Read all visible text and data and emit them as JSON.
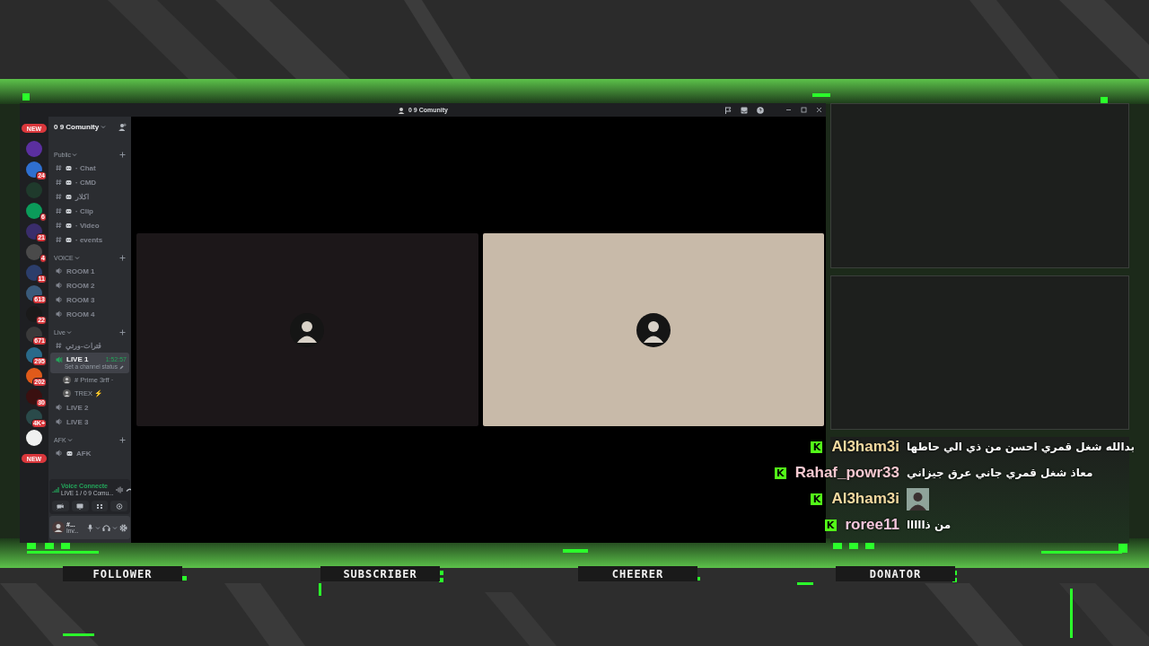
{
  "window": {
    "title": "0 9 Comunity"
  },
  "servers": [
    {
      "kind": "new",
      "label": "NEW"
    },
    {
      "kind": "server",
      "color": "#5b2fa0"
    },
    {
      "kind": "server",
      "color": "#2f6fd0",
      "badge": "24"
    },
    {
      "kind": "server",
      "color": "#1f3a2c"
    },
    {
      "kind": "server",
      "color": "#0b9b5a",
      "badge": "6"
    },
    {
      "kind": "server",
      "color": "#3a2d6b",
      "badge": "21"
    },
    {
      "kind": "server",
      "color": "#4a4a4a",
      "badge": "4"
    },
    {
      "kind": "server",
      "color": "#2c3e6b",
      "badge": "11"
    },
    {
      "kind": "server",
      "color": "#3a5a7a",
      "badge": "613"
    },
    {
      "kind": "server",
      "color": "#1a1a1a",
      "badge": "22"
    },
    {
      "kind": "server",
      "color": "#3a3a3a",
      "badge": "671"
    },
    {
      "kind": "server",
      "color": "#2a6a8a",
      "badge": "295"
    },
    {
      "kind": "server",
      "color": "#e05a1a",
      "badge": "202"
    },
    {
      "kind": "server",
      "color": "#3a1010",
      "badge": "30"
    },
    {
      "kind": "server",
      "color": "#2a4a4a",
      "badge": "4K+"
    },
    {
      "kind": "server",
      "color": "#f0f0f0"
    },
    {
      "kind": "new",
      "label": "NEW"
    }
  ],
  "server_name": "0 9 Comunity",
  "categories": [
    {
      "name": "Public",
      "channels": [
        {
          "kind": "text",
          "name": "· Chat",
          "emoji": true,
          "selected": false
        },
        {
          "kind": "text",
          "name": "· CMD",
          "emoji": true,
          "selected": false
        },
        {
          "kind": "text",
          "name": "اكلار",
          "emoji": true,
          "selected": false
        },
        {
          "kind": "text",
          "name": "· Clip",
          "emoji": true,
          "selected": false
        },
        {
          "kind": "text",
          "name": "· Video",
          "emoji": true,
          "selected": false
        },
        {
          "kind": "text",
          "name": "· events",
          "emoji": true,
          "selected": false
        }
      ]
    },
    {
      "name": "VOICE",
      "channels": [
        {
          "kind": "voice",
          "name": "ROOM 1",
          "selected": false
        },
        {
          "kind": "voice",
          "name": "ROOM 2",
          "selected": false
        },
        {
          "kind": "voice",
          "name": "ROOM 3",
          "selected": false
        },
        {
          "kind": "voice",
          "name": "ROOM 4",
          "selected": false
        }
      ]
    },
    {
      "name": "Live",
      "channels": [
        {
          "kind": "text",
          "name": "قترات-ورتي",
          "selected": false
        },
        {
          "kind": "voice",
          "name": "LIVE 1",
          "selected": true,
          "timer": "1:52:57",
          "status": "Set a channel status",
          "members": [
            {
              "name": "# Prime 3rff ·"
            },
            {
              "name": "TREX ⚡"
            }
          ]
        },
        {
          "kind": "voice",
          "name": "LIVE 2",
          "selected": false
        },
        {
          "kind": "voice",
          "name": "LIVE 3",
          "selected": false
        }
      ]
    },
    {
      "name": "AFK",
      "channels": [
        {
          "kind": "voice",
          "name": "AFK",
          "emoji": true,
          "selected": false
        }
      ]
    }
  ],
  "voice_panel": {
    "status": "Voice Connecte",
    "location": "LIVE 1 / 0 9 Comu..."
  },
  "user_panel": {
    "name": "#...",
    "status": "Inv..."
  },
  "video_tiles": [
    {
      "color": "#1c1719"
    },
    {
      "color": "#c8baa9"
    }
  ],
  "chat": [
    {
      "kind": "text",
      "badge": "K",
      "user": "Al3ham3i",
      "color": "#f3d9a0",
      "text": "بدالله شغل قمري احسن من ذي الي حاطها"
    },
    {
      "kind": "text",
      "badge": "K",
      "user": "Rahaf_powr33",
      "color": "#f5c8d0",
      "text": "معاذ شغل قمري جاني عرق جيزاني"
    },
    {
      "kind": "image",
      "badge": "K",
      "user": "Al3ham3i",
      "color": "#f3d9a0"
    },
    {
      "kind": "text",
      "badge": "K",
      "user": "roree11",
      "color": "#f4c6dc",
      "text": "من ذااااا"
    }
  ],
  "overlay_labels": [
    "FOLLOWER",
    "SUBSCRIBER",
    "CHEERER",
    "DONATOR"
  ]
}
